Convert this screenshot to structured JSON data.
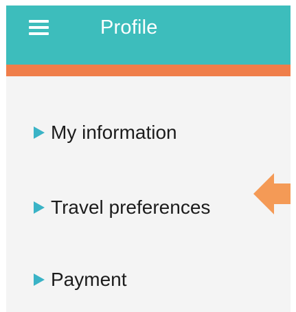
{
  "header": {
    "title": "Profile",
    "menu_icon": "hamburger-menu-icon",
    "bar_color": "#3dbdbc",
    "accent_color": "#ef7e4a"
  },
  "menu": {
    "bullet_icon": "triangle-right-icon",
    "bullet_color": "#3ab3c6",
    "items": [
      {
        "label": "My information"
      },
      {
        "label": "Travel preferences",
        "highlighted": true
      },
      {
        "label": "Payment"
      }
    ]
  },
  "annotation": {
    "icon": "left-pointing-arrow-icon",
    "color": "#f49a56",
    "points_to": "Travel preferences"
  }
}
